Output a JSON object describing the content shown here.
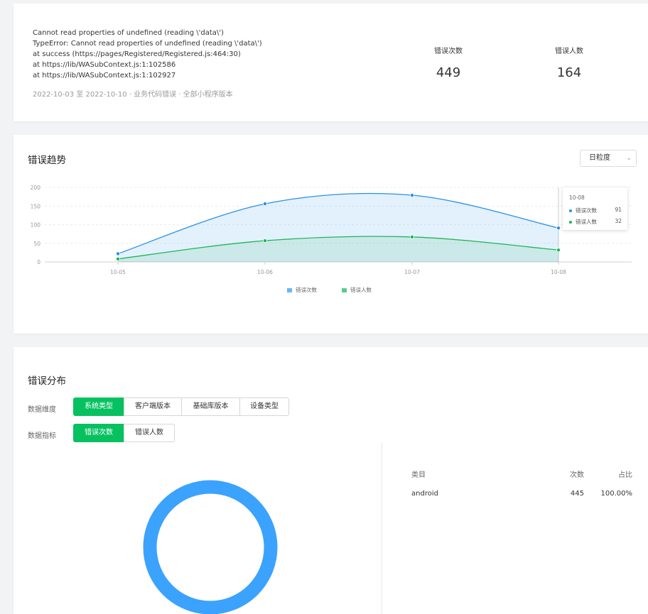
{
  "summary": {
    "error_lines": [
      "Cannot read properties of undefined (reading \\'data\\')",
      "TypeError: Cannot read properties of undefined (reading \\'data\\')",
      "at success (https://pages/Registered/Registered.js:464:30)",
      "at https://lib/WASubContext.js:1:102586",
      "at https://lib/WASubContext.js:1:102927"
    ],
    "meta": "2022-10-03 至  2022-10-10 ·  业务代码错误 ·  全部小程序版本",
    "stats": [
      {
        "label": "错误次数",
        "value": "449"
      },
      {
        "label": "错误人数",
        "value": "164"
      }
    ]
  },
  "trend": {
    "title": "错误趋势",
    "granularity": "日粒度",
    "tooltip": {
      "date": "10-08",
      "rows": [
        {
          "label": "错误次数",
          "value": "91"
        },
        {
          "label": "错误人数",
          "value": "32"
        }
      ]
    }
  },
  "chart_data": {
    "type": "area",
    "categories": [
      "10-05",
      "10-06",
      "10-07",
      "10-08"
    ],
    "series": [
      {
        "name": "错误次数",
        "values": [
          22,
          156,
          179,
          91
        ],
        "color": "#2990e8"
      },
      {
        "name": "错误人数",
        "values": [
          8,
          57,
          67,
          32
        ],
        "color": "#1fb45a"
      }
    ],
    "yticks": [
      "200",
      "150",
      "100",
      "50",
      "0"
    ],
    "ylim": [
      0,
      200
    ],
    "grid": true,
    "legend_position": "bottom"
  },
  "distribution": {
    "title": "错误分布",
    "dimension_label": "数据维度",
    "dimension_options": [
      "系统类型",
      "客户端版本",
      "基础库版本",
      "设备类型"
    ],
    "metric_label": "数据指标",
    "metric_options": [
      "错误次数",
      "错误人数"
    ],
    "table": {
      "headers": [
        "类目",
        "次数",
        "占比"
      ],
      "rows": [
        {
          "category": "android",
          "count": "445",
          "ratio": "100.00%"
        }
      ]
    },
    "donut_color": "#3ba2fd",
    "donut_values": [
      {
        "category": "android",
        "value": 445
      }
    ]
  }
}
